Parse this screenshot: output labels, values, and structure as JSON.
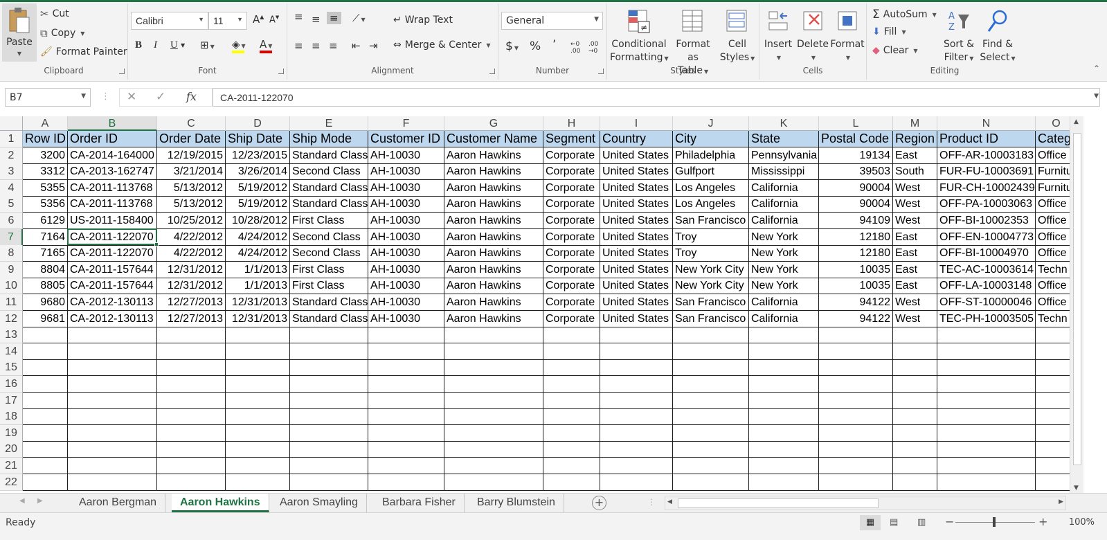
{
  "ribbon": {
    "clipboard": {
      "label": "Clipboard",
      "paste": "Paste",
      "cut": "Cut",
      "copy": "Copy",
      "format_painter": "Format Painter"
    },
    "font": {
      "label": "Font",
      "font_name": "Calibri",
      "font_size": "11",
      "bold": "B",
      "italic": "I",
      "underline": "U"
    },
    "alignment": {
      "label": "Alignment",
      "wrap_text": "Wrap Text",
      "merge_center": "Merge & Center"
    },
    "number": {
      "label": "Number",
      "format": "General",
      "currency": "$",
      "percent": "%",
      "comma": "’"
    },
    "styles": {
      "label": "Styles",
      "conditional": [
        "Conditional",
        "Formatting"
      ],
      "format_table": [
        "Format as",
        "Table"
      ],
      "cell_styles": [
        "Cell",
        "Styles"
      ]
    },
    "cells": {
      "label": "Cells",
      "insert": "Insert",
      "delete": "Delete",
      "format": "Format"
    },
    "editing": {
      "label": "Editing",
      "autosum": "AutoSum",
      "fill": "Fill",
      "clear": "Clear",
      "sort_filter": [
        "Sort &",
        "Filter"
      ],
      "find_select": [
        "Find &",
        "Select"
      ]
    }
  },
  "formula_bar": {
    "name_box": "B7",
    "formula": "CA-2011-122070",
    "fx": "fx"
  },
  "grid": {
    "columns": [
      "A",
      "B",
      "C",
      "D",
      "E",
      "F",
      "G",
      "H",
      "I",
      "J",
      "K",
      "L",
      "M",
      "N",
      "O"
    ],
    "selected_col": "B",
    "selected_row": "7",
    "rows": [
      "1",
      "2",
      "3",
      "4",
      "5",
      "6",
      "7",
      "8",
      "9",
      "10",
      "11",
      "12",
      "13",
      "14",
      "15",
      "16",
      "17",
      "18",
      "19",
      "20",
      "21",
      "22"
    ],
    "headers": [
      "Row ID",
      "Order ID",
      "Order Date",
      "Ship Date",
      "Ship Mode",
      "Customer ID",
      "Customer Name",
      "Segment",
      "Country",
      "City",
      "State",
      "Postal Code",
      "Region",
      "Product ID",
      "Categ"
    ],
    "data": [
      [
        "3200",
        "CA-2014-164000",
        "12/19/2015",
        "12/23/2015",
        "Standard Class",
        "AH-10030",
        "Aaron Hawkins",
        "Corporate",
        "United States",
        "Philadelphia",
        "Pennsylvania",
        "19134",
        "East",
        "OFF-AR-10003183",
        "Office"
      ],
      [
        "3312",
        "CA-2013-162747",
        "3/21/2014",
        "3/26/2014",
        "Second Class",
        "AH-10030",
        "Aaron Hawkins",
        "Corporate",
        "United States",
        "Gulfport",
        "Mississippi",
        "39503",
        "South",
        "FUR-FU-10003691",
        "Furnitu"
      ],
      [
        "5355",
        "CA-2011-113768",
        "5/13/2012",
        "5/19/2012",
        "Standard Class",
        "AH-10030",
        "Aaron Hawkins",
        "Corporate",
        "United States",
        "Los Angeles",
        "California",
        "90004",
        "West",
        "FUR-CH-10002439",
        "Furnitu"
      ],
      [
        "5356",
        "CA-2011-113768",
        "5/13/2012",
        "5/19/2012",
        "Standard Class",
        "AH-10030",
        "Aaron Hawkins",
        "Corporate",
        "United States",
        "Los Angeles",
        "California",
        "90004",
        "West",
        "OFF-PA-10003063",
        "Office"
      ],
      [
        "6129",
        "US-2011-158400",
        "10/25/2012",
        "10/28/2012",
        "First Class",
        "AH-10030",
        "Aaron Hawkins",
        "Corporate",
        "United States",
        "San Francisco",
        "California",
        "94109",
        "West",
        "OFF-BI-10002353",
        "Office"
      ],
      [
        "7164",
        "CA-2011-122070",
        "4/22/2012",
        "4/24/2012",
        "Second Class",
        "AH-10030",
        "Aaron Hawkins",
        "Corporate",
        "United States",
        "Troy",
        "New York",
        "12180",
        "East",
        "OFF-EN-10004773",
        "Office"
      ],
      [
        "7165",
        "CA-2011-122070",
        "4/22/2012",
        "4/24/2012",
        "Second Class",
        "AH-10030",
        "Aaron Hawkins",
        "Corporate",
        "United States",
        "Troy",
        "New York",
        "12180",
        "East",
        "OFF-BI-10004970",
        "Office"
      ],
      [
        "8804",
        "CA-2011-157644",
        "12/31/2012",
        "1/1/2013",
        "First Class",
        "AH-10030",
        "Aaron Hawkins",
        "Corporate",
        "United States",
        "New York City",
        "New York",
        "10035",
        "East",
        "TEC-AC-10003614",
        "Techn"
      ],
      [
        "8805",
        "CA-2011-157644",
        "12/31/2012",
        "1/1/2013",
        "First Class",
        "AH-10030",
        "Aaron Hawkins",
        "Corporate",
        "United States",
        "New York City",
        "New York",
        "10035",
        "East",
        "OFF-LA-10003148",
        "Office"
      ],
      [
        "9680",
        "CA-2012-130113",
        "12/27/2013",
        "12/31/2013",
        "Standard Class",
        "AH-10030",
        "Aaron Hawkins",
        "Corporate",
        "United States",
        "San Francisco",
        "California",
        "94122",
        "West",
        "OFF-ST-10000046",
        "Office"
      ],
      [
        "9681",
        "CA-2012-130113",
        "12/27/2013",
        "12/31/2013",
        "Standard Class",
        "AH-10030",
        "Aaron Hawkins",
        "Corporate",
        "United States",
        "San Francisco",
        "California",
        "94122",
        "West",
        "TEC-PH-10003505",
        "Techn"
      ]
    ]
  },
  "sheets": {
    "tabs": [
      "Aaron Bergman",
      "Aaron Hawkins",
      "Aaron Smayling",
      "Barbara Fisher",
      "Barry Blumstein"
    ],
    "active": "Aaron Hawkins"
  },
  "status": {
    "ready": "Ready",
    "zoom": "100%"
  },
  "colors": {
    "accent": "#217346",
    "header_fill": "#bdd7ee"
  }
}
